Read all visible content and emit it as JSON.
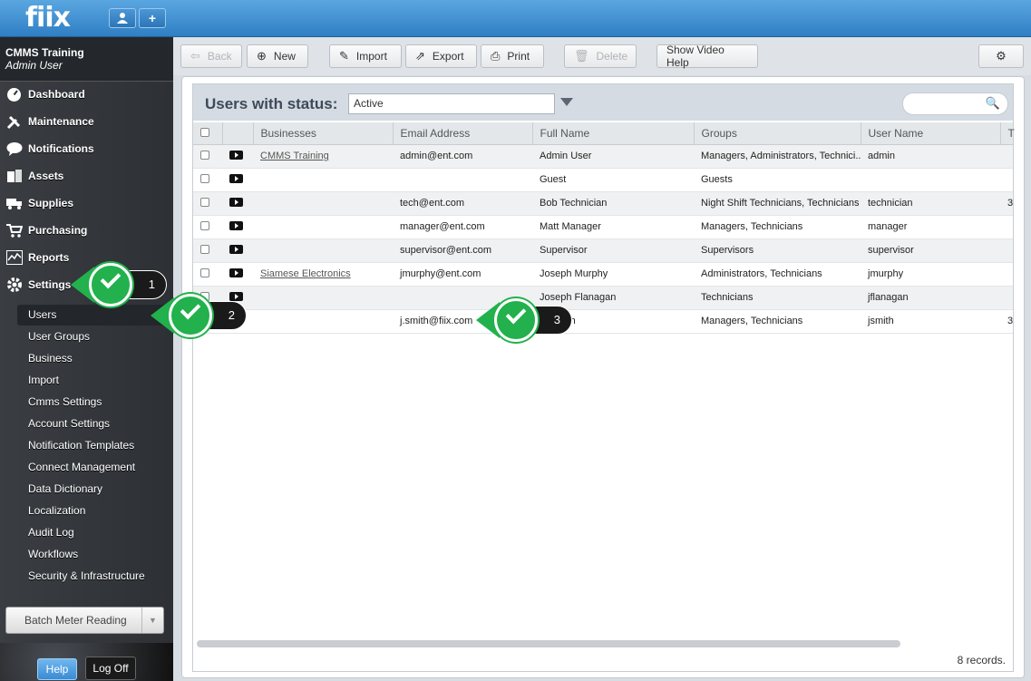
{
  "app": {
    "logo": "fiix"
  },
  "account": {
    "company": "CMMS Training",
    "user": "Admin User"
  },
  "nav": [
    {
      "label": "Dashboard",
      "icon": "dashboard-icon"
    },
    {
      "label": "Maintenance",
      "icon": "wrench-icon"
    },
    {
      "label": "Notifications",
      "icon": "speech-bubble-icon"
    },
    {
      "label": "Assets",
      "icon": "boxes-icon"
    },
    {
      "label": "Supplies",
      "icon": "truck-icon"
    },
    {
      "label": "Purchasing",
      "icon": "cart-icon"
    },
    {
      "label": "Reports",
      "icon": "chart-icon"
    },
    {
      "label": "Settings",
      "icon": "gear-icon"
    }
  ],
  "settings_sub": [
    "Users",
    "User Groups",
    "Business",
    "Import",
    "Cmms Settings",
    "Account Settings",
    "Notification Templates",
    "Connect Management",
    "Data Dictionary",
    "Localization",
    "Audit Log",
    "Workflows",
    "Security & Infrastructure"
  ],
  "batch_label": "Batch Meter Reading",
  "help_label": "Help",
  "logoff_label": "Log Off",
  "toolbar": {
    "back": "Back",
    "new": "New",
    "import": "Import",
    "export": "Export",
    "print": "Print",
    "delete": "Delete",
    "video_help": "Show Video Help"
  },
  "filter": {
    "label": "Users with status:",
    "status": "Active"
  },
  "table": {
    "columns": [
      "Businesses",
      "Email Address",
      "Full Name",
      "Groups",
      "User Name",
      "T"
    ],
    "rows": [
      {
        "business": "CMMS Training",
        "email": "admin@ent.com",
        "name": "Admin User",
        "groups": "Managers, Administrators, Technici...",
        "username": "admin",
        "extra": ""
      },
      {
        "business": "",
        "email": "",
        "name": "Guest",
        "groups": "Guests",
        "username": "",
        "extra": ""
      },
      {
        "business": "",
        "email": "tech@ent.com",
        "name": "Bob Technician",
        "groups": "Night Shift Technicians, Technicians",
        "username": "technician",
        "extra": "3"
      },
      {
        "business": "",
        "email": "manager@ent.com",
        "name": "Matt Manager",
        "groups": "Managers, Technicians",
        "username": "manager",
        "extra": ""
      },
      {
        "business": "",
        "email": "supervisor@ent.com",
        "name": "Supervisor",
        "groups": "Supervisors",
        "username": "supervisor",
        "extra": ""
      },
      {
        "business": "Siamese Electronics",
        "email": "jmurphy@ent.com",
        "name": "Joseph Murphy",
        "groups": "Administrators, Technicians",
        "username": "jmurphy",
        "extra": ""
      },
      {
        "business": "",
        "email": "",
        "name": "Joseph Flanagan",
        "groups": "Technicians",
        "username": "jflanagan",
        "extra": ""
      },
      {
        "business": "",
        "email": "j.smith@fiix.com",
        "name": "J. Smith",
        "groups": "Managers, Technicians",
        "username": "jsmith",
        "extra": "3"
      }
    ]
  },
  "records": "8 records.",
  "callouts": [
    "1",
    "2",
    "3"
  ],
  "colors": {
    "accent": "#2f7fc4",
    "callout_green": "#22b14c"
  }
}
